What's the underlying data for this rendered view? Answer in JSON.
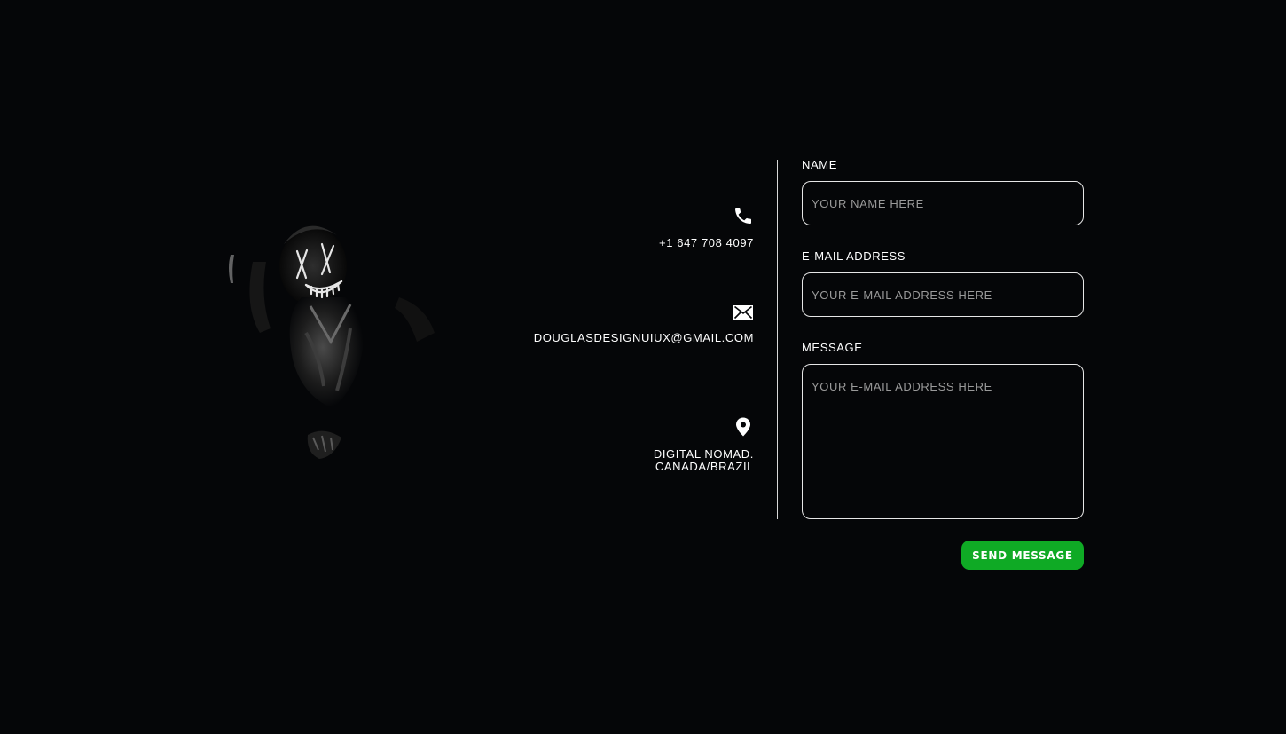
{
  "contact": {
    "phone": {
      "icon": "phone-icon",
      "text": "+1 647 708 4097"
    },
    "email": {
      "icon": "envelope-icon",
      "text": "DOUGLASDESIGNUIUX@GMAIL.COM"
    },
    "location": {
      "icon": "map-pin-icon",
      "line1": "DIGITAL NOMAD.",
      "line2": "CANADA/BRAZIL"
    }
  },
  "form": {
    "name": {
      "label": "NAME",
      "placeholder": "YOUR NAME HERE",
      "value": ""
    },
    "email": {
      "label": "E-MAIL ADDRESS",
      "placeholder": "YOUR E-MAIL ADDRESS HERE",
      "value": ""
    },
    "message": {
      "label": "MESSAGE",
      "placeholder": "YOUR E-MAIL ADDRESS HERE",
      "value": ""
    },
    "submit_label": "SEND MESSAGE"
  },
  "colors": {
    "background": "#050608",
    "accent": "#0faa25",
    "text": "#ffffff",
    "placeholder": "#9a9a9a"
  }
}
